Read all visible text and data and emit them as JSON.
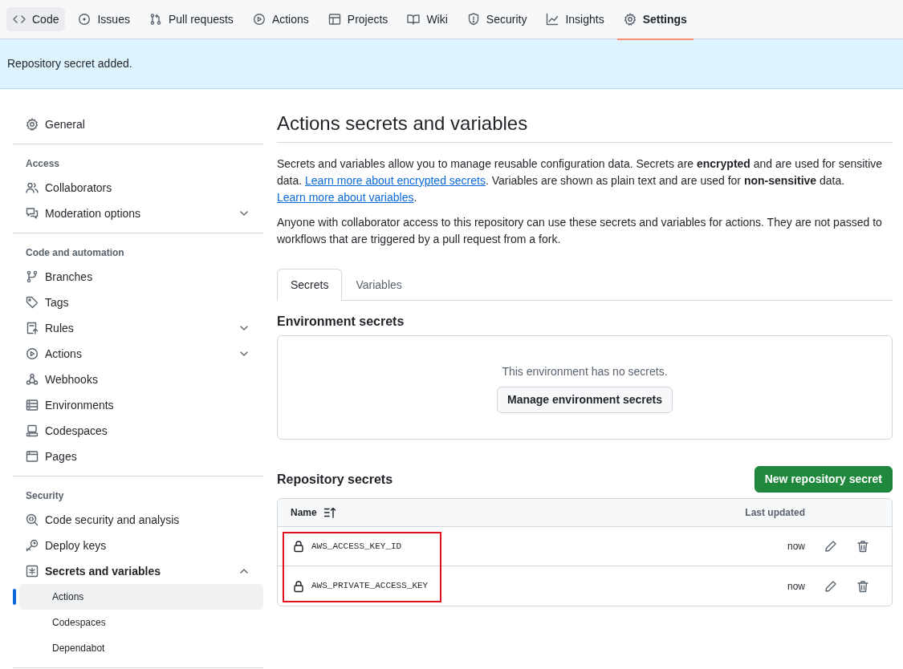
{
  "repo_nav": [
    {
      "label": "Code",
      "selected": false,
      "hovered": true
    },
    {
      "label": "Issues",
      "selected": false,
      "hovered": false
    },
    {
      "label": "Pull requests",
      "selected": false,
      "hovered": false
    },
    {
      "label": "Actions",
      "selected": false,
      "hovered": false
    },
    {
      "label": "Projects",
      "selected": false,
      "hovered": false
    },
    {
      "label": "Wiki",
      "selected": false,
      "hovered": false
    },
    {
      "label": "Security",
      "selected": false,
      "hovered": false
    },
    {
      "label": "Insights",
      "selected": false,
      "hovered": false
    },
    {
      "label": "Settings",
      "selected": true,
      "hovered": false
    }
  ],
  "flash": "Repository secret added.",
  "sidebar": {
    "sections": [
      {
        "items": [
          {
            "label": "General"
          }
        ]
      },
      {
        "heading": "Access",
        "items": [
          {
            "label": "Collaborators"
          },
          {
            "label": "Moderation options",
            "expanded": false
          }
        ]
      },
      {
        "heading": "Code and automation",
        "items": [
          {
            "label": "Branches"
          },
          {
            "label": "Tags"
          },
          {
            "label": "Rules",
            "expanded": false
          },
          {
            "label": "Actions",
            "expanded": false
          },
          {
            "label": "Webhooks"
          },
          {
            "label": "Environments"
          },
          {
            "label": "Codespaces"
          },
          {
            "label": "Pages"
          }
        ]
      },
      {
        "heading": "Security",
        "items": [
          {
            "label": "Code security and analysis"
          },
          {
            "label": "Deploy keys"
          },
          {
            "label": "Secrets and variables",
            "expanded": true,
            "children": [
              {
                "label": "Actions",
                "selected": true
              },
              {
                "label": "Codespaces",
                "selected": false
              },
              {
                "label": "Dependabot",
                "selected": false
              }
            ]
          }
        ]
      }
    ]
  },
  "main": {
    "title": "Actions secrets and variables",
    "paragraphs": [
      [
        {
          "text": "Secrets and variables allow you to manage reusable configuration data. Secrets are **encrypted** and are used for sensitive data. "
        },
        {
          "link": "Learn more about encrypted secrets"
        },
        {
          "text": ". Variables are shown as plain text and are used for **non-sensitive** data. "
        },
        {
          "link": "Learn more about variables"
        },
        {
          "text": "."
        }
      ],
      [
        {
          "text": "Anyone with collaborator access to this repository can use these secrets and variables for actions. They are not passed to workflows that are triggered by a pull request from a fork."
        }
      ]
    ],
    "tabs": [
      {
        "label": "Secrets",
        "selected": true
      },
      {
        "label": "Variables",
        "selected": false
      }
    ],
    "environment_secrets": {
      "heading": "Environment secrets",
      "empty_text": "This environment has no secrets.",
      "button": "Manage environment secrets"
    },
    "repository_secrets": {
      "heading": "Repository secrets",
      "button": "New repository secret",
      "columns": [
        "Name",
        "Last updated"
      ],
      "rows": [
        {
          "name": "AWS_ACCESS_KEY_ID",
          "updated": "now",
          "highlighted": true
        },
        {
          "name": "AWS_PRIVATE_ACCESS_KEY",
          "updated": "now",
          "highlighted": true
        }
      ]
    }
  }
}
